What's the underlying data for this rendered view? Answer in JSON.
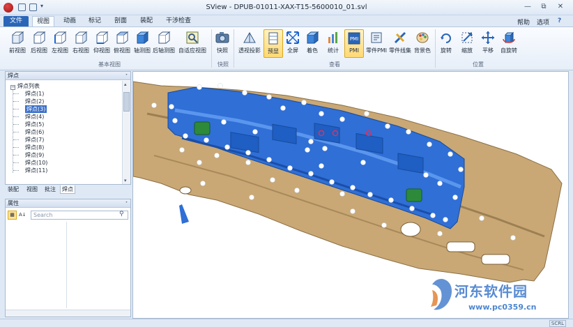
{
  "window": {
    "title": "SView - DPUB-01011-XAX-T15-5600010_01.svl",
    "minimize": "—",
    "restore": "⧉",
    "close": "✕"
  },
  "menu": {
    "tabs": [
      "文件",
      "视图",
      "动画",
      "标记",
      "剖面",
      "装配",
      "干涉检查"
    ],
    "help": "帮助",
    "options": "选项",
    "help_icon": "?"
  },
  "ribbon": {
    "groups": [
      {
        "label": "基本视图",
        "buttons": [
          "前视图",
          "后视图",
          "左视图",
          "右视图",
          "仰视图",
          "俯视图",
          "轴测图",
          "后轴测图",
          "自适应视图"
        ]
      },
      {
        "label": "快照",
        "buttons": [
          "快照"
        ]
      },
      {
        "label": "查看",
        "buttons": [
          "透视投影",
          "预显",
          "全屏",
          "着色",
          "统计",
          "PMI",
          "零件PMI",
          "零件线集",
          "背景色"
        ]
      },
      {
        "label": "位置",
        "buttons": [
          "旋转",
          "缩放",
          "平移",
          "自旋转"
        ]
      }
    ]
  },
  "weld_panel": {
    "title": "焊点",
    "root": "焊点列表",
    "items": [
      "焊点(1)",
      "焊点(2)",
      "焊点(3)",
      "焊点(4)",
      "焊点(5)",
      "焊点(6)",
      "焊点(7)",
      "焊点(8)",
      "焊点(9)",
      "焊点(10)",
      "焊点(11)"
    ],
    "selected_index": 2
  },
  "bottom_tabs": [
    "装配",
    "视图",
    "批注",
    "焊点"
  ],
  "properties_panel": {
    "title": "属性",
    "search_placeholder": "Search"
  },
  "status": {
    "scroll": "SCRL"
  },
  "watermark": {
    "name": "河东软件园",
    "url": "www.pc0359.cn"
  },
  "colors": {
    "part_blue": "#2f6fd6",
    "part_tan": "#c9a875",
    "weld_point": "#ffffff",
    "weld_selected": "#e0305a",
    "clip_green": "#2d8a3a"
  }
}
